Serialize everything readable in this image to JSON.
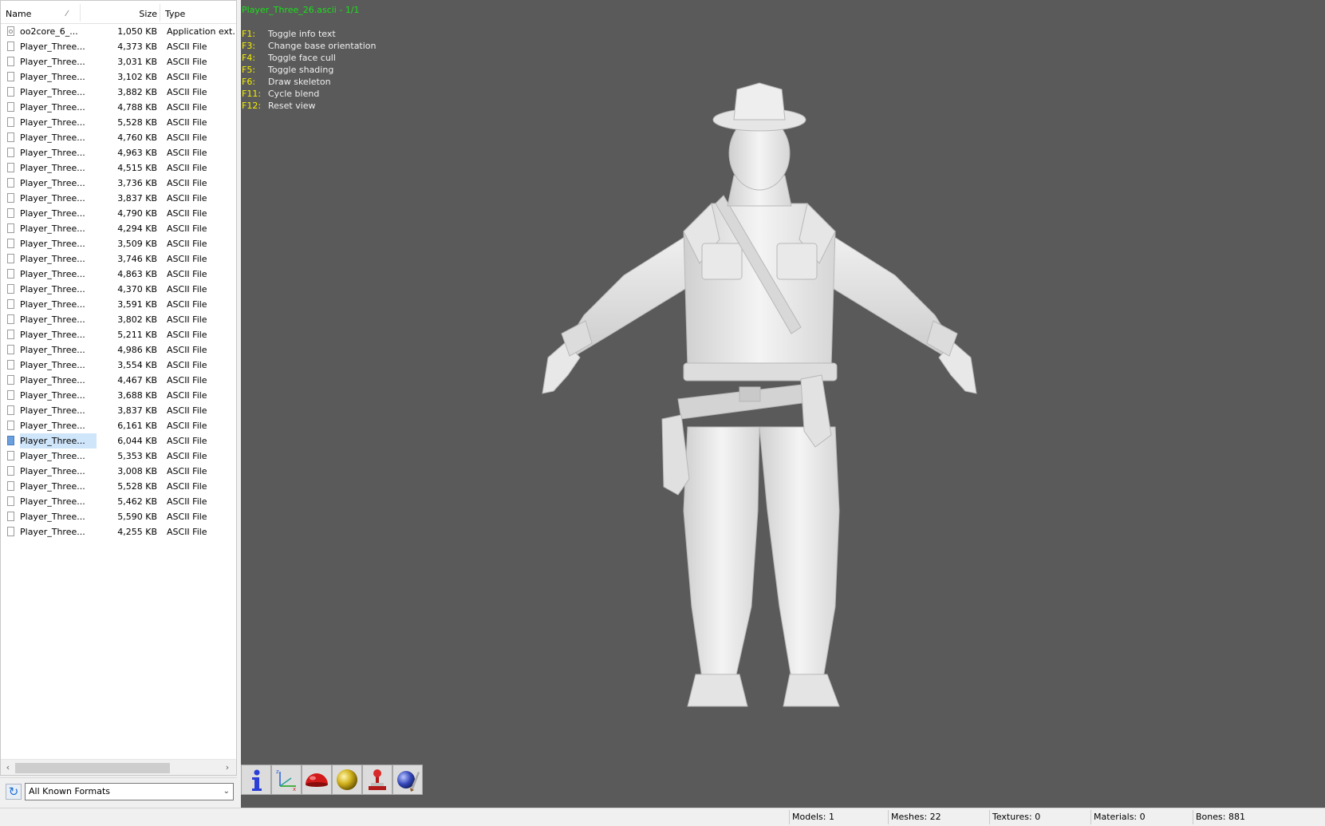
{
  "file_browser": {
    "columns": {
      "name": "Name",
      "sort_marker": "⁄",
      "size": "Size",
      "type": "Type"
    },
    "files": [
      {
        "name": "oo2core_6_...",
        "size": "1,050 KB",
        "type": "Application ext..."
      },
      {
        "name": "Player_Three...",
        "size": "4,373 KB",
        "type": "ASCII File"
      },
      {
        "name": "Player_Three...",
        "size": "3,031 KB",
        "type": "ASCII File"
      },
      {
        "name": "Player_Three...",
        "size": "3,102 KB",
        "type": "ASCII File"
      },
      {
        "name": "Player_Three...",
        "size": "3,882 KB",
        "type": "ASCII File"
      },
      {
        "name": "Player_Three...",
        "size": "4,788 KB",
        "type": "ASCII File"
      },
      {
        "name": "Player_Three...",
        "size": "5,528 KB",
        "type": "ASCII File"
      },
      {
        "name": "Player_Three...",
        "size": "4,760 KB",
        "type": "ASCII File"
      },
      {
        "name": "Player_Three...",
        "size": "4,963 KB",
        "type": "ASCII File"
      },
      {
        "name": "Player_Three...",
        "size": "4,515 KB",
        "type": "ASCII File"
      },
      {
        "name": "Player_Three...",
        "size": "3,736 KB",
        "type": "ASCII File"
      },
      {
        "name": "Player_Three...",
        "size": "3,837 KB",
        "type": "ASCII File"
      },
      {
        "name": "Player_Three...",
        "size": "4,790 KB",
        "type": "ASCII File"
      },
      {
        "name": "Player_Three...",
        "size": "4,294 KB",
        "type": "ASCII File"
      },
      {
        "name": "Player_Three...",
        "size": "3,509 KB",
        "type": "ASCII File"
      },
      {
        "name": "Player_Three...",
        "size": "3,746 KB",
        "type": "ASCII File"
      },
      {
        "name": "Player_Three...",
        "size": "4,863 KB",
        "type": "ASCII File"
      },
      {
        "name": "Player_Three...",
        "size": "4,370 KB",
        "type": "ASCII File"
      },
      {
        "name": "Player_Three...",
        "size": "3,591 KB",
        "type": "ASCII File"
      },
      {
        "name": "Player_Three...",
        "size": "3,802 KB",
        "type": "ASCII File"
      },
      {
        "name": "Player_Three...",
        "size": "5,211 KB",
        "type": "ASCII File"
      },
      {
        "name": "Player_Three...",
        "size": "4,986 KB",
        "type": "ASCII File"
      },
      {
        "name": "Player_Three...",
        "size": "3,554 KB",
        "type": "ASCII File"
      },
      {
        "name": "Player_Three...",
        "size": "4,467 KB",
        "type": "ASCII File"
      },
      {
        "name": "Player_Three...",
        "size": "3,688 KB",
        "type": "ASCII File"
      },
      {
        "name": "Player_Three...",
        "size": "3,837 KB",
        "type": "ASCII File"
      },
      {
        "name": "Player_Three...",
        "size": "6,161 KB",
        "type": "ASCII File"
      },
      {
        "name": "Player_Three...",
        "size": "6,044 KB",
        "type": "ASCII File",
        "selected": true
      },
      {
        "name": "Player_Three...",
        "size": "5,353 KB",
        "type": "ASCII File"
      },
      {
        "name": "Player_Three...",
        "size": "3,008 KB",
        "type": "ASCII File"
      },
      {
        "name": "Player_Three...",
        "size": "5,528 KB",
        "type": "ASCII File"
      },
      {
        "name": "Player_Three...",
        "size": "5,462 KB",
        "type": "ASCII File"
      },
      {
        "name": "Player_Three...",
        "size": "5,590 KB",
        "type": "ASCII File"
      },
      {
        "name": "Player_Three...",
        "size": "4,255 KB",
        "type": "ASCII File"
      }
    ],
    "format_filter": "All Known Formats"
  },
  "viewport": {
    "title": "Player_Three_26.ascii - 1/1",
    "help_lines": [
      {
        "key": "F1:",
        "action": "Toggle info text"
      },
      {
        "key": "F3:",
        "action": "Change base orientation"
      },
      {
        "key": "F4:",
        "action": "Toggle face cull"
      },
      {
        "key": "F5:",
        "action": "Toggle shading"
      },
      {
        "key": "F6:",
        "action": "Draw skeleton"
      },
      {
        "key": "F11:",
        "action": "Cycle blend"
      },
      {
        "key": "F12:",
        "action": "Reset view"
      }
    ],
    "toolbar_icons": [
      "info-icon",
      "axes-icon",
      "hemisphere-icon",
      "sphere-icon",
      "joystick-icon",
      "globe-brush-icon"
    ],
    "colors": {
      "background": "#5a5a5a",
      "title": "#19e019",
      "key": "#f5f000",
      "text": "#f0f0f0"
    }
  },
  "status": {
    "models": "Models: 1",
    "meshes": "Meshes: 22",
    "textures": "Textures: 0",
    "materials": "Materials: 0",
    "bones": "Bones: 881"
  }
}
